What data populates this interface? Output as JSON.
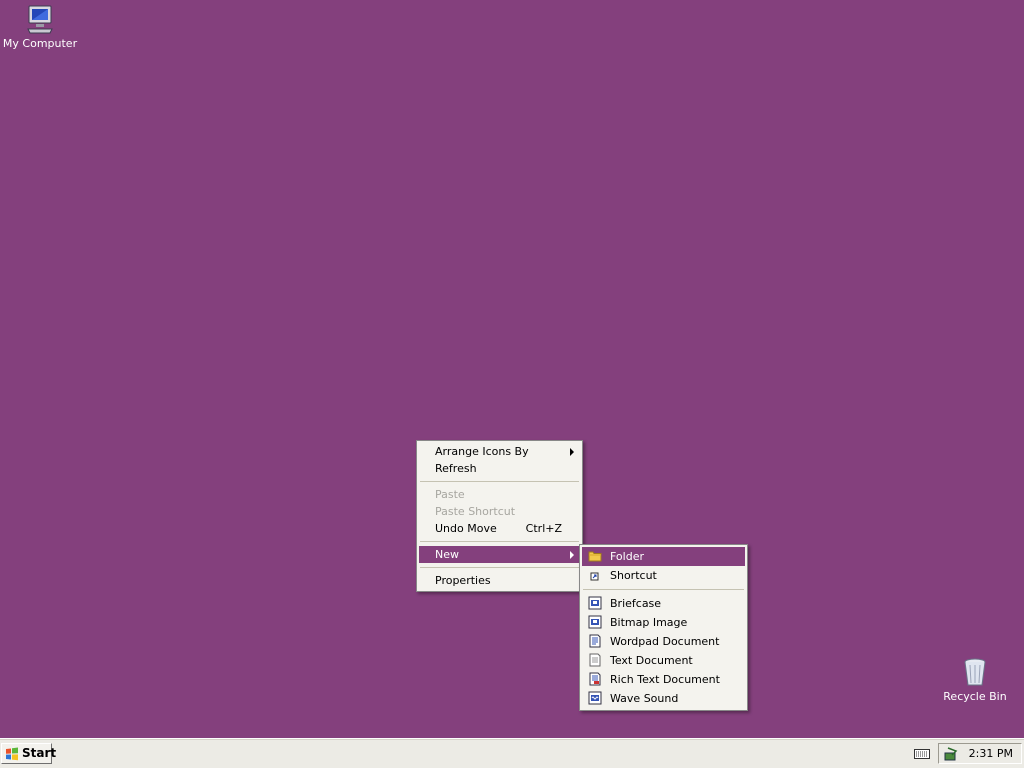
{
  "desktop": {
    "background_color": "#84407d",
    "icons": [
      {
        "label": "My Computer",
        "icon": "my-computer-icon"
      },
      {
        "label": "Recycle Bin",
        "icon": "recycle-bin-icon"
      }
    ]
  },
  "context_menu": {
    "items": [
      {
        "label": "Arrange Icons By",
        "has_submenu": true
      },
      {
        "label": "Refresh"
      },
      {
        "label": "Paste",
        "disabled": true
      },
      {
        "label": "Paste Shortcut",
        "disabled": true
      },
      {
        "label": "Undo Move",
        "shortcut": "Ctrl+Z"
      },
      {
        "label": "New",
        "has_submenu": true,
        "selected": true
      },
      {
        "label": "Properties"
      }
    ]
  },
  "new_submenu": {
    "items": [
      {
        "label": "Folder",
        "icon": "folder-icon",
        "selected": true
      },
      {
        "label": "Shortcut",
        "icon": "shortcut-icon"
      },
      {
        "label": "Briefcase",
        "icon": "briefcase-icon"
      },
      {
        "label": "Bitmap Image",
        "icon": "bitmap-image-icon"
      },
      {
        "label": "Wordpad Document",
        "icon": "wordpad-document-icon"
      },
      {
        "label": "Text Document",
        "icon": "text-document-icon"
      },
      {
        "label": "Rich Text Document",
        "icon": "rich-text-document-icon"
      },
      {
        "label": "Wave Sound",
        "icon": "wave-sound-icon"
      }
    ]
  },
  "taskbar": {
    "start_label": "Start",
    "clock": "2:31 PM",
    "colors": {
      "bar": "#ecebe5",
      "highlight": "#84407d"
    }
  }
}
